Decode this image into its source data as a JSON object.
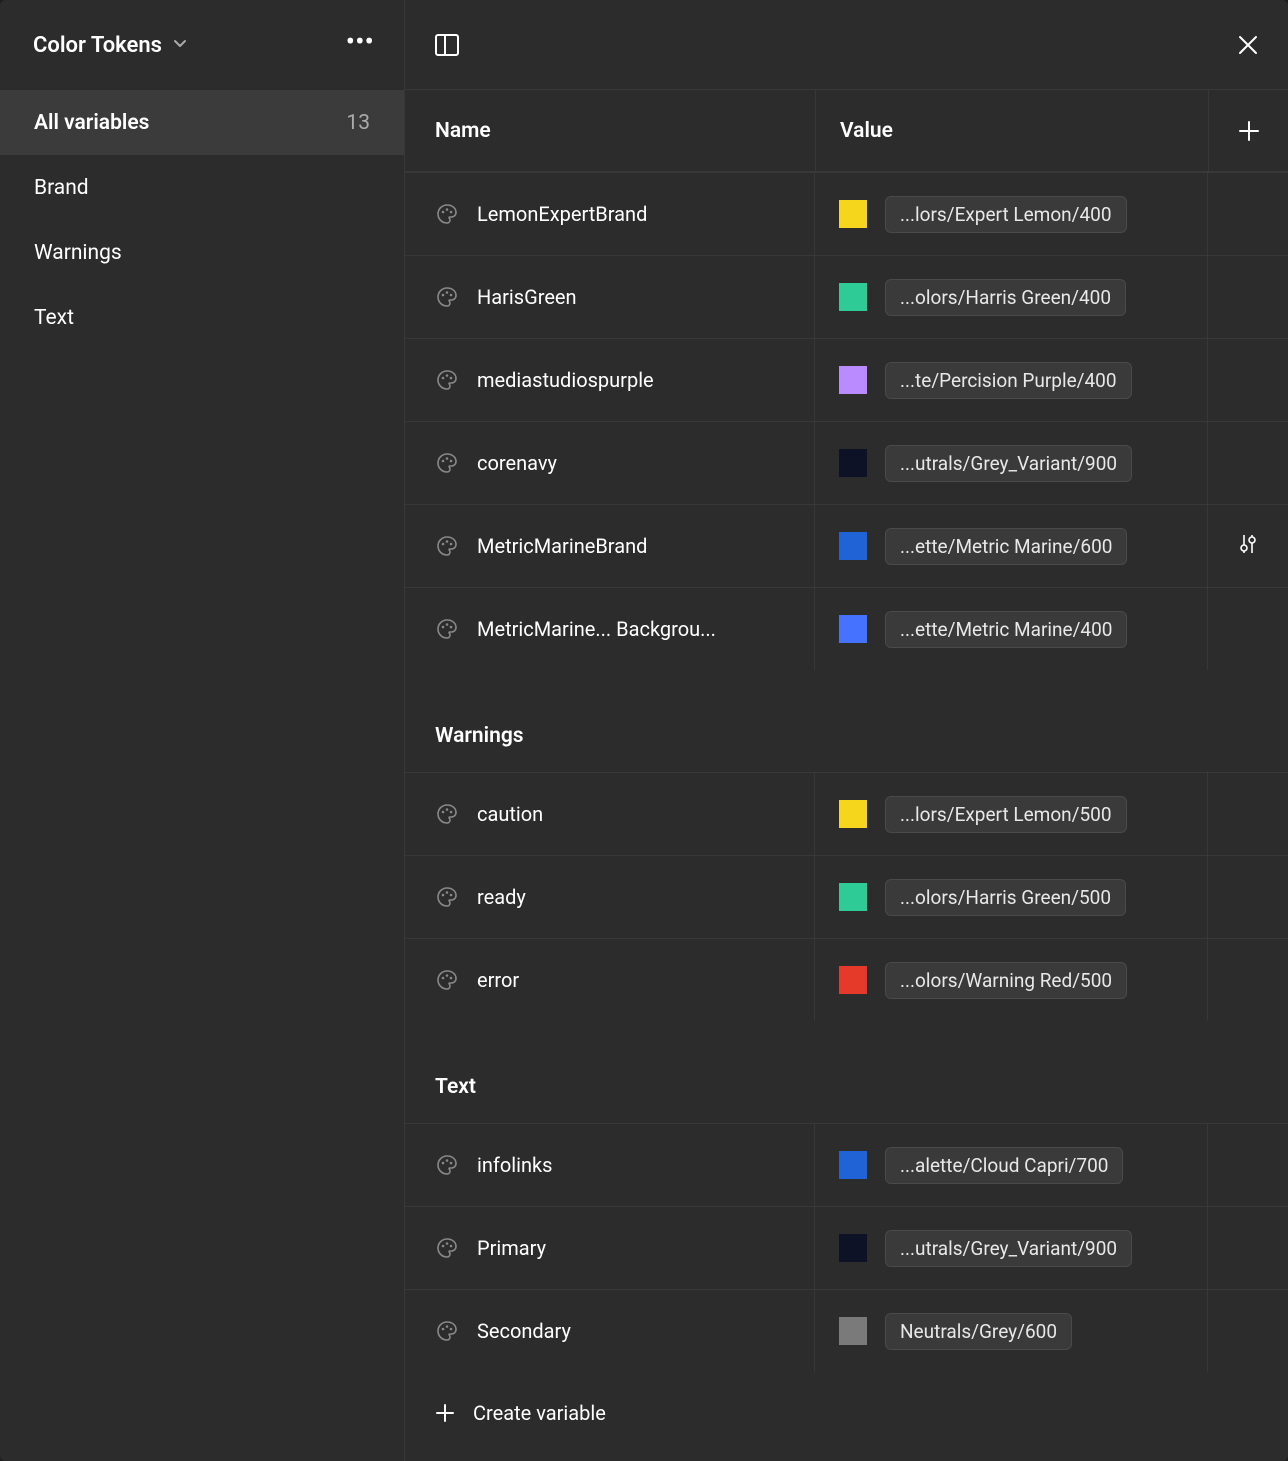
{
  "sidebar": {
    "title": "Color Tokens",
    "items": [
      {
        "label": "All variables",
        "count": "13",
        "active": true
      },
      {
        "label": "Brand",
        "count": "",
        "active": false
      },
      {
        "label": "Warnings",
        "count": "",
        "active": false
      },
      {
        "label": "Text",
        "count": "",
        "active": false
      }
    ]
  },
  "columns": {
    "name": "Name",
    "value": "Value"
  },
  "groups": [
    {
      "header": "",
      "rows": [
        {
          "name": "LemonExpertBrand",
          "swatch": "#f5d61c",
          "pill": "...lors/Expert Lemon/400",
          "sliders": false
        },
        {
          "name": "HarisGreen",
          "swatch": "#2ecb97",
          "pill": "...olors/Harris Green/400",
          "sliders": false
        },
        {
          "name": "mediastudiospurple",
          "swatch": "#b98bff",
          "pill": "...te/Percision Purple/400",
          "sliders": false
        },
        {
          "name": "corenavy",
          "swatch": "#0d1227",
          "pill": "...utrals/Grey_Variant/900",
          "sliders": false
        },
        {
          "name": "MetricMarineBrand",
          "swatch": "#1f63d6",
          "pill": "...ette/Metric Marine/600",
          "sliders": true
        },
        {
          "name": "MetricMarine... Backgrou...",
          "swatch": "#4573ff",
          "pill": "...ette/Metric Marine/400",
          "sliders": false
        }
      ]
    },
    {
      "header": "Warnings",
      "rows": [
        {
          "name": "caution",
          "swatch": "#f5d61c",
          "pill": "...lors/Expert Lemon/500",
          "sliders": false
        },
        {
          "name": "ready",
          "swatch": "#2ecb97",
          "pill": "...olors/Harris Green/500",
          "sliders": false
        },
        {
          "name": "error",
          "swatch": "#e53a2a",
          "pill": "...olors/Warning Red/500",
          "sliders": false
        }
      ]
    },
    {
      "header": "Text",
      "rows": [
        {
          "name": "infolinks",
          "swatch": "#1f63d6",
          "pill": "...alette/Cloud Capri/700",
          "sliders": false
        },
        {
          "name": "Primary",
          "swatch": "#0d1227",
          "pill": "...utrals/Grey_Variant/900",
          "sliders": false
        },
        {
          "name": "Secondary",
          "swatch": "#7a7a7a",
          "pill": "Neutrals/Grey/600",
          "sliders": false
        }
      ]
    }
  ],
  "create_label": "Create variable"
}
